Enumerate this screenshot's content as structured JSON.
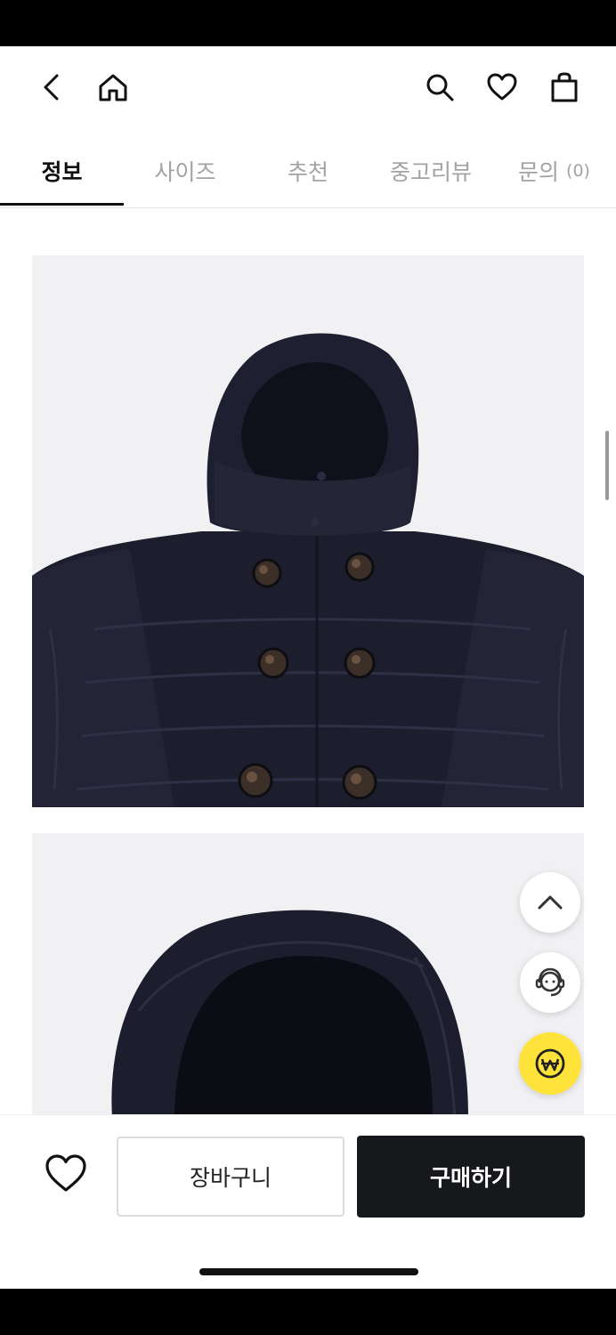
{
  "tabs": [
    {
      "label": "정보",
      "count": ""
    },
    {
      "label": "사이즈",
      "count": ""
    },
    {
      "label": "추천",
      "count": ""
    },
    {
      "label": "중고리뷰",
      "count": ""
    },
    {
      "label": "문의",
      "count": "(0)"
    }
  ],
  "active_tab": "정보",
  "product": {
    "images": [
      {
        "subject": "navy puffer coat with hood, front view"
      },
      {
        "subject": "navy puffer coat hood close-up"
      }
    ]
  },
  "actions": {
    "cart_label": "장바구니",
    "buy_label": "구매하기"
  },
  "colors": {
    "accent_yellow": "#ffe33a",
    "buy_button": "#16181b",
    "coat_navy": "#1c1d2d"
  },
  "icons": [
    "back-arrow-icon",
    "home-icon",
    "search-icon",
    "heart-icon",
    "shopping-bag-icon",
    "chevron-up-icon",
    "customer-service-icon",
    "won-coin-icon"
  ]
}
